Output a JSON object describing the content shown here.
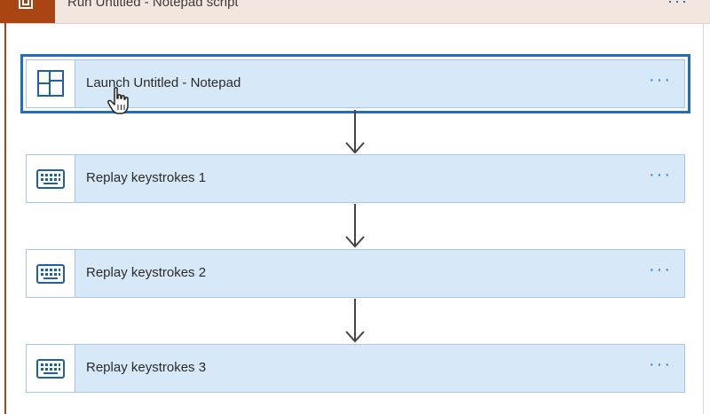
{
  "header": {
    "title": "Run Untitled - Notepad script",
    "more": "···"
  },
  "steps": [
    {
      "label": "Launch Untitled - Notepad",
      "icon": "window-layout-icon",
      "more": "···",
      "selected": true
    },
    {
      "label": "Replay keystrokes 1",
      "icon": "keyboard-icon",
      "more": "···"
    },
    {
      "label": "Replay keystrokes 2",
      "icon": "keyboard-icon",
      "more": "···"
    },
    {
      "label": "Replay keystrokes 3",
      "icon": "keyboard-icon",
      "more": "···"
    }
  ],
  "colors": {
    "container_accent": "#a84512",
    "card_fill": "#d7e8f8",
    "selection_outline": "#1c6fc3",
    "ellipsis": "#2f7fd1"
  }
}
